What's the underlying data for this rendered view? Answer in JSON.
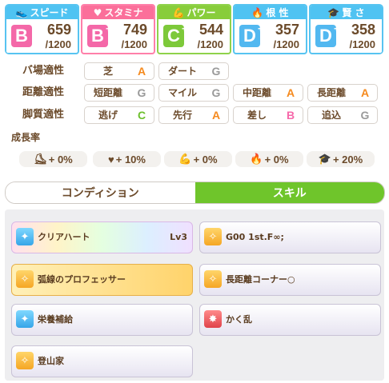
{
  "stats": [
    {
      "key": "speed",
      "label": "スピード",
      "icon": "shoe-icon",
      "grade": "B",
      "plus": "",
      "value": "659",
      "max": "/1200",
      "color": "#4fc3f2"
    },
    {
      "key": "stamina",
      "label": "スタミナ",
      "icon": "heart-icon",
      "grade": "B",
      "plus": "+",
      "value": "749",
      "max": "/1200",
      "color": "#fb6f9a"
    },
    {
      "key": "power",
      "label": "パワー",
      "icon": "muscle-icon",
      "grade": "C",
      "plus": "+",
      "value": "544",
      "max": "/1200",
      "color": "#88cd3b"
    },
    {
      "key": "guts",
      "label": "根 性",
      "icon": "flame-icon",
      "grade": "D",
      "plus": "+",
      "value": "357",
      "max": "/1200",
      "color": "#4fc3f2"
    },
    {
      "key": "wit",
      "label": "賢 さ",
      "icon": "graduation-cap-icon",
      "grade": "D",
      "plus": "+",
      "value": "358",
      "max": "/1200",
      "color": "#4fc3f2"
    }
  ],
  "aptitudes": {
    "track": {
      "label": "バ場適性",
      "items": [
        {
          "name": "芝",
          "grade": "A"
        },
        {
          "name": "ダート",
          "grade": "G"
        }
      ]
    },
    "distance": {
      "label": "距離適性",
      "items": [
        {
          "name": "短距離",
          "grade": "G"
        },
        {
          "name": "マイル",
          "grade": "G"
        },
        {
          "name": "中距離",
          "grade": "A"
        },
        {
          "name": "長距離",
          "grade": "A"
        }
      ]
    },
    "style": {
      "label": "脚質適性",
      "items": [
        {
          "name": "逃げ",
          "grade": "C"
        },
        {
          "name": "先行",
          "grade": "A"
        },
        {
          "name": "差し",
          "grade": "B"
        },
        {
          "name": "追込",
          "grade": "G"
        }
      ]
    }
  },
  "growth": {
    "title": "成長率",
    "items": [
      {
        "icon": "shoe-icon",
        "glyph": "⛸",
        "value": "+ 0%"
      },
      {
        "icon": "heart-icon",
        "glyph": "♥",
        "value": "+ 10%"
      },
      {
        "icon": "muscle-icon",
        "glyph": "💪",
        "value": "+ 0%"
      },
      {
        "icon": "flame-icon",
        "glyph": "🔥",
        "value": "+ 0%"
      },
      {
        "icon": "graduation-cap-icon",
        "glyph": "🎓",
        "value": "+ 20%"
      }
    ]
  },
  "tabs": {
    "condition": "コンディション",
    "skill": "スキル"
  },
  "skills": [
    {
      "name": "クリアハート",
      "level": "Lv3",
      "icon": "sparkle-icon",
      "style": "rainbow",
      "iconColor": "blue"
    },
    {
      "name": "G00 1st.F∞;",
      "level": "",
      "icon": "gold-skill-icon",
      "style": "normal",
      "iconColor": "gold"
    },
    {
      "name": "弧線のプロフェッサー",
      "level": "",
      "icon": "gold-skill-icon",
      "style": "gold",
      "iconColor": "gold"
    },
    {
      "name": "長距離コーナー○",
      "level": "",
      "icon": "gold-skill-icon",
      "style": "normal",
      "iconColor": "gold"
    },
    {
      "name": "栄養補給",
      "level": "",
      "icon": "sparkle-icon",
      "style": "normal",
      "iconColor": "blue"
    },
    {
      "name": "かく乱",
      "level": "",
      "icon": "debuff-icon",
      "style": "normal",
      "iconColor": "red"
    },
    {
      "name": "登山家",
      "level": "",
      "icon": "gold-skill-icon",
      "style": "normal",
      "iconColor": "gold"
    }
  ]
}
